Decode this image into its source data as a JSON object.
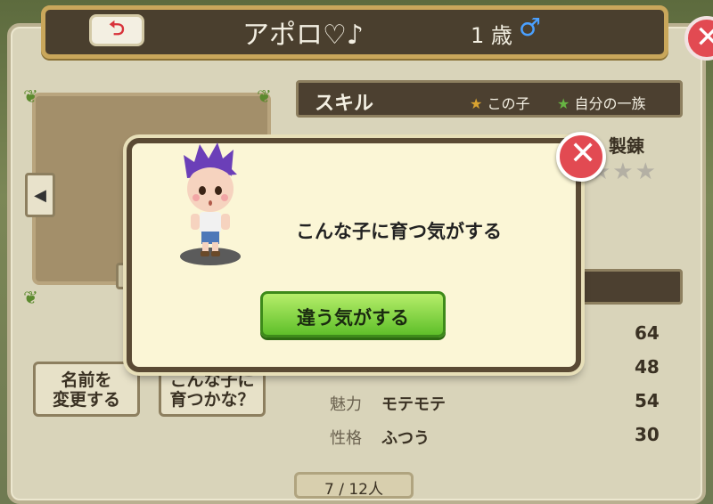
{
  "header": {
    "name": "アポロ♡♪",
    "age": "1 歳",
    "gender_symbol": "♂",
    "back_icon": "back-arrow-icon"
  },
  "left": {
    "rename_button": "名前を\n変更する",
    "grow_button": "こんな子に\n育つかな？"
  },
  "skills": {
    "title": "スキル",
    "legend_this": "この子",
    "legend_family": "自分の一族",
    "skill_name": "製錬",
    "stars": "★★★"
  },
  "stats": [
    {
      "label": "",
      "value": "",
      "number": "64"
    },
    {
      "label": "",
      "value": "",
      "number": "48"
    },
    {
      "label": "魅力",
      "value": "モテモテ",
      "number": "54"
    },
    {
      "label": "性格",
      "value": "ふつう",
      "number": "30"
    }
  ],
  "pager": {
    "text": "7 / 12人"
  },
  "dialog": {
    "message": "こんな子に育つ気がする",
    "action": "違う気がする"
  },
  "colors": {
    "close_red": "#e24a52",
    "action_green": "#5fbf2a",
    "header_brown": "#4a3f2e"
  }
}
